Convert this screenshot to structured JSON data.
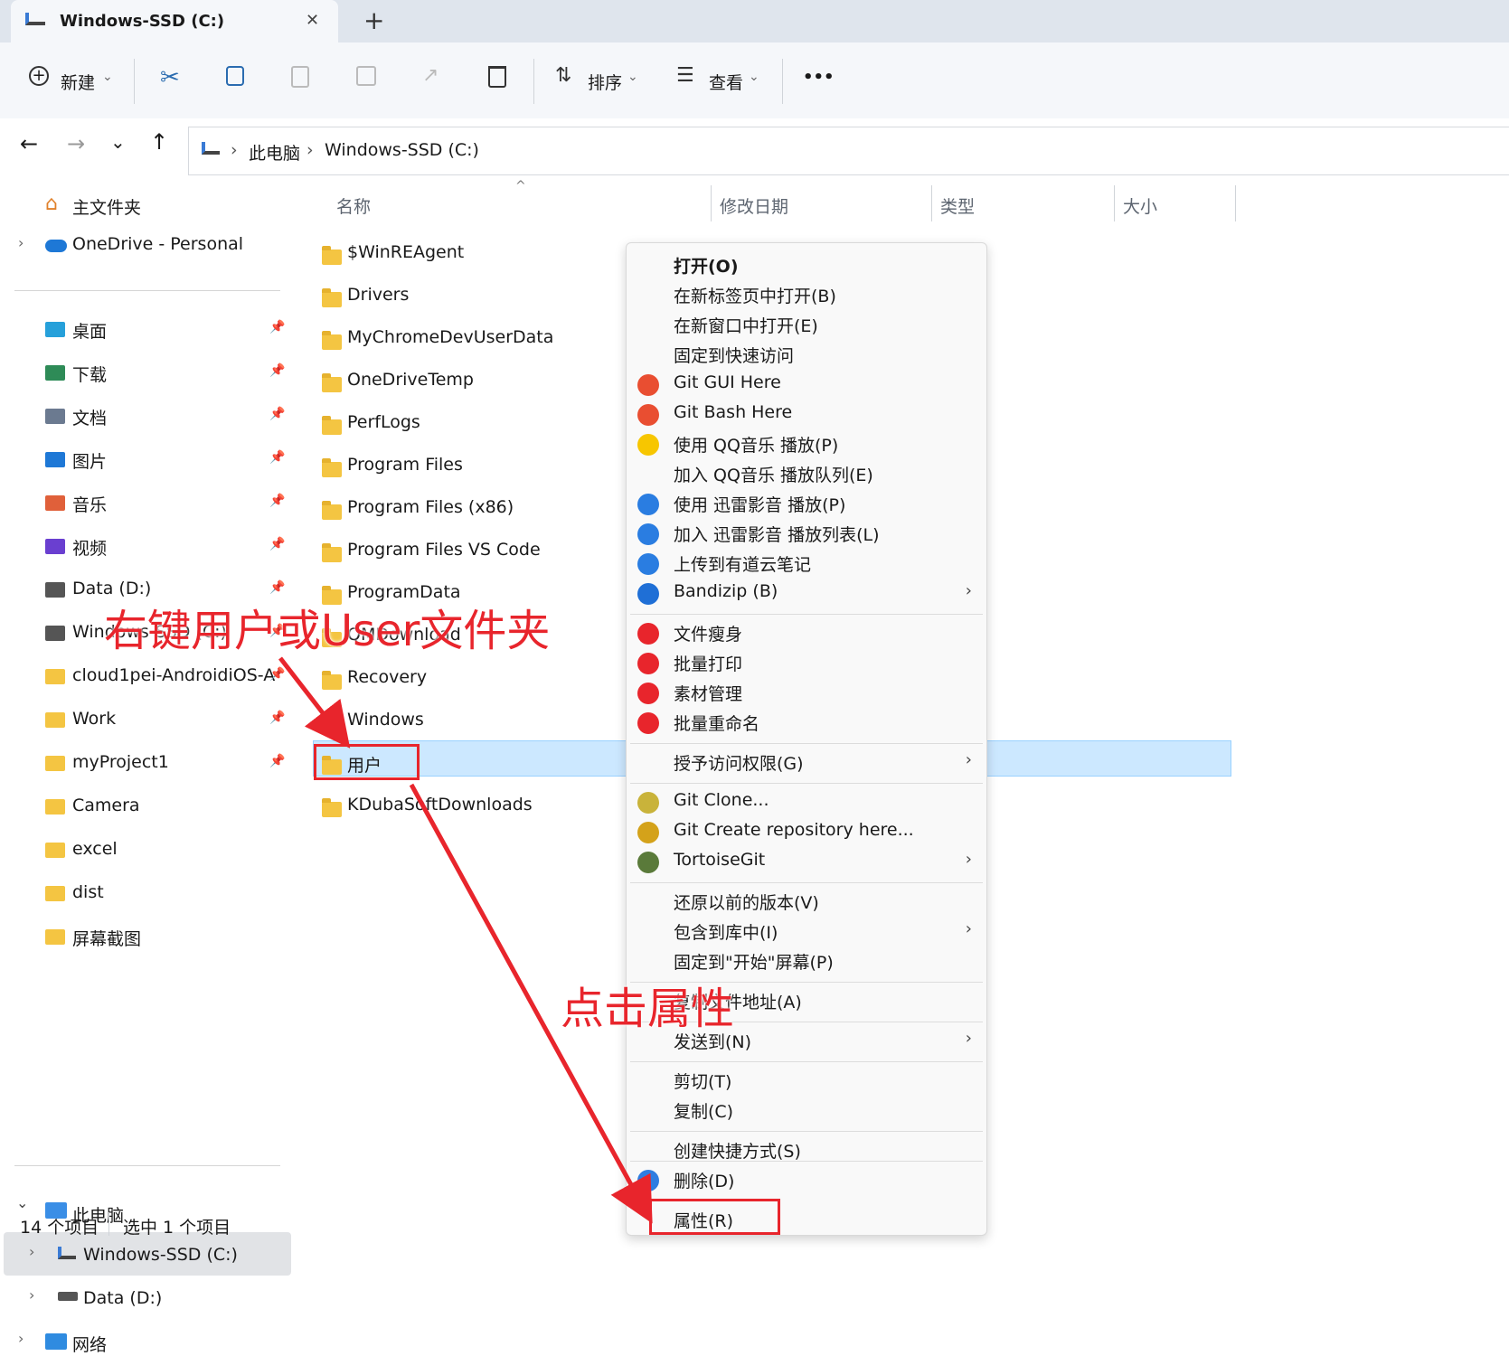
{
  "tab": {
    "title": "Windows-SSD (C:)",
    "close": "✕",
    "new": "+"
  },
  "toolbar": {
    "new_label": "新建",
    "sort_label": "排序",
    "view_label": "查看",
    "more": "•••"
  },
  "address": {
    "pc": "此电脑",
    "drive": "Windows-SSD (C:)"
  },
  "sidebar": {
    "home": "主文件夹",
    "onedrive": "OneDrive - Personal",
    "quick": [
      "桌面",
      "下载",
      "文档",
      "图片",
      "音乐",
      "视频",
      "Data (D:)",
      "Windows-SSD (C:)",
      "cloud1pei-AndroidiOS-A",
      "Work",
      "myProject1",
      "Camera",
      "excel",
      "dist",
      "屏幕截图"
    ],
    "pc": "此电脑",
    "pc_items": [
      "Windows-SSD (C:)",
      "Data (D:)"
    ],
    "network": "网络"
  },
  "columns": {
    "name": "名称",
    "date": "修改日期",
    "type": "类型",
    "size": "大小"
  },
  "files": [
    "$WinREAgent",
    "Drivers",
    "MyChromeDevUserData",
    "OneDriveTemp",
    "PerfLogs",
    "Program Files",
    "Program Files (x86)",
    "Program Files VS Code",
    "ProgramData",
    "QMDownload",
    "Recovery",
    "Windows",
    "用户",
    "KDubaSoftDownloads"
  ],
  "menu": {
    "items": [
      "打开(O)",
      "在新标签页中打开(B)",
      "在新窗口中打开(E)",
      "固定到快速访问",
      "Git GUI Here",
      "Git Bash Here",
      "使用 QQ音乐 播放(P)",
      "加入 QQ音乐 播放队列(E)",
      "使用 迅雷影音 播放(P)",
      "加入 迅雷影音 播放列表(L)",
      "上传到有道云笔记",
      "Bandizip (B)",
      "文件瘦身",
      "批量打印",
      "素材管理",
      "批量重命名",
      "授予访问权限(G)",
      "Git Clone...",
      "Git Create repository here...",
      "TortoiseGit",
      "还原以前的版本(V)",
      "包含到库中(I)",
      "固定到\"开始\"屏幕(P)",
      "复制文件地址(A)",
      "发送到(N)",
      "剪切(T)",
      "复制(C)",
      "创建快捷方式(S)",
      "删除(D)",
      "属性(R)"
    ]
  },
  "annotations": {
    "right_click": "右键用户或User文件夹",
    "click_props": "点击属性"
  },
  "status": {
    "count": "14 个项目",
    "selected": "选中 1 个项目"
  },
  "colors": {
    "selection": "#cce8ff",
    "annotation": "#e8252c",
    "folder": "#f4c542"
  }
}
